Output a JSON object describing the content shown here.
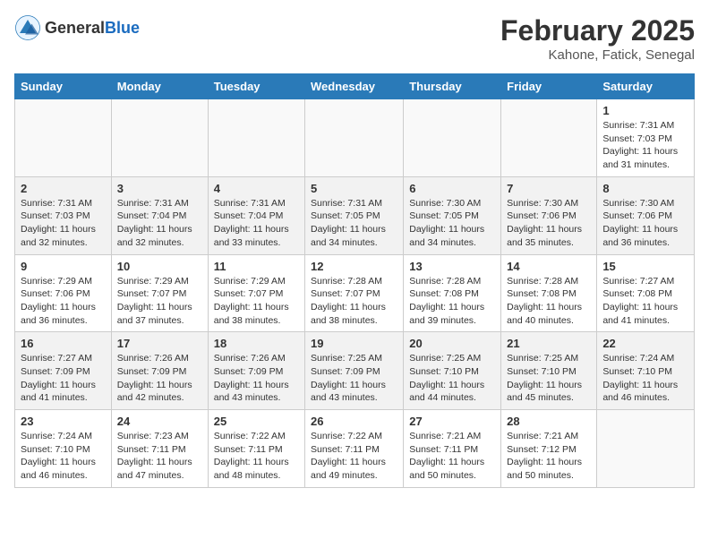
{
  "header": {
    "logo_general": "General",
    "logo_blue": "Blue",
    "month": "February 2025",
    "location": "Kahone, Fatick, Senegal"
  },
  "weekdays": [
    "Sunday",
    "Monday",
    "Tuesday",
    "Wednesday",
    "Thursday",
    "Friday",
    "Saturday"
  ],
  "weeks": [
    [
      {
        "day": "",
        "sunrise": "",
        "sunset": "",
        "daylight": "",
        "empty": true
      },
      {
        "day": "",
        "sunrise": "",
        "sunset": "",
        "daylight": "",
        "empty": true
      },
      {
        "day": "",
        "sunrise": "",
        "sunset": "",
        "daylight": "",
        "empty": true
      },
      {
        "day": "",
        "sunrise": "",
        "sunset": "",
        "daylight": "",
        "empty": true
      },
      {
        "day": "",
        "sunrise": "",
        "sunset": "",
        "daylight": "",
        "empty": true
      },
      {
        "day": "",
        "sunrise": "",
        "sunset": "",
        "daylight": "",
        "empty": true
      },
      {
        "day": "1",
        "sunrise": "Sunrise: 7:31 AM",
        "sunset": "Sunset: 7:03 PM",
        "daylight": "Daylight: 11 hours and 31 minutes.",
        "empty": false
      }
    ],
    [
      {
        "day": "2",
        "sunrise": "Sunrise: 7:31 AM",
        "sunset": "Sunset: 7:03 PM",
        "daylight": "Daylight: 11 hours and 32 minutes.",
        "empty": false
      },
      {
        "day": "3",
        "sunrise": "Sunrise: 7:31 AM",
        "sunset": "Sunset: 7:04 PM",
        "daylight": "Daylight: 11 hours and 32 minutes.",
        "empty": false
      },
      {
        "day": "4",
        "sunrise": "Sunrise: 7:31 AM",
        "sunset": "Sunset: 7:04 PM",
        "daylight": "Daylight: 11 hours and 33 minutes.",
        "empty": false
      },
      {
        "day": "5",
        "sunrise": "Sunrise: 7:31 AM",
        "sunset": "Sunset: 7:05 PM",
        "daylight": "Daylight: 11 hours and 34 minutes.",
        "empty": false
      },
      {
        "day": "6",
        "sunrise": "Sunrise: 7:30 AM",
        "sunset": "Sunset: 7:05 PM",
        "daylight": "Daylight: 11 hours and 34 minutes.",
        "empty": false
      },
      {
        "day": "7",
        "sunrise": "Sunrise: 7:30 AM",
        "sunset": "Sunset: 7:06 PM",
        "daylight": "Daylight: 11 hours and 35 minutes.",
        "empty": false
      },
      {
        "day": "8",
        "sunrise": "Sunrise: 7:30 AM",
        "sunset": "Sunset: 7:06 PM",
        "daylight": "Daylight: 11 hours and 36 minutes.",
        "empty": false
      }
    ],
    [
      {
        "day": "9",
        "sunrise": "Sunrise: 7:29 AM",
        "sunset": "Sunset: 7:06 PM",
        "daylight": "Daylight: 11 hours and 36 minutes.",
        "empty": false
      },
      {
        "day": "10",
        "sunrise": "Sunrise: 7:29 AM",
        "sunset": "Sunset: 7:07 PM",
        "daylight": "Daylight: 11 hours and 37 minutes.",
        "empty": false
      },
      {
        "day": "11",
        "sunrise": "Sunrise: 7:29 AM",
        "sunset": "Sunset: 7:07 PM",
        "daylight": "Daylight: 11 hours and 38 minutes.",
        "empty": false
      },
      {
        "day": "12",
        "sunrise": "Sunrise: 7:28 AM",
        "sunset": "Sunset: 7:07 PM",
        "daylight": "Daylight: 11 hours and 38 minutes.",
        "empty": false
      },
      {
        "day": "13",
        "sunrise": "Sunrise: 7:28 AM",
        "sunset": "Sunset: 7:08 PM",
        "daylight": "Daylight: 11 hours and 39 minutes.",
        "empty": false
      },
      {
        "day": "14",
        "sunrise": "Sunrise: 7:28 AM",
        "sunset": "Sunset: 7:08 PM",
        "daylight": "Daylight: 11 hours and 40 minutes.",
        "empty": false
      },
      {
        "day": "15",
        "sunrise": "Sunrise: 7:27 AM",
        "sunset": "Sunset: 7:08 PM",
        "daylight": "Daylight: 11 hours and 41 minutes.",
        "empty": false
      }
    ],
    [
      {
        "day": "16",
        "sunrise": "Sunrise: 7:27 AM",
        "sunset": "Sunset: 7:09 PM",
        "daylight": "Daylight: 11 hours and 41 minutes.",
        "empty": false
      },
      {
        "day": "17",
        "sunrise": "Sunrise: 7:26 AM",
        "sunset": "Sunset: 7:09 PM",
        "daylight": "Daylight: 11 hours and 42 minutes.",
        "empty": false
      },
      {
        "day": "18",
        "sunrise": "Sunrise: 7:26 AM",
        "sunset": "Sunset: 7:09 PM",
        "daylight": "Daylight: 11 hours and 43 minutes.",
        "empty": false
      },
      {
        "day": "19",
        "sunrise": "Sunrise: 7:25 AM",
        "sunset": "Sunset: 7:09 PM",
        "daylight": "Daylight: 11 hours and 43 minutes.",
        "empty": false
      },
      {
        "day": "20",
        "sunrise": "Sunrise: 7:25 AM",
        "sunset": "Sunset: 7:10 PM",
        "daylight": "Daylight: 11 hours and 44 minutes.",
        "empty": false
      },
      {
        "day": "21",
        "sunrise": "Sunrise: 7:25 AM",
        "sunset": "Sunset: 7:10 PM",
        "daylight": "Daylight: 11 hours and 45 minutes.",
        "empty": false
      },
      {
        "day": "22",
        "sunrise": "Sunrise: 7:24 AM",
        "sunset": "Sunset: 7:10 PM",
        "daylight": "Daylight: 11 hours and 46 minutes.",
        "empty": false
      }
    ],
    [
      {
        "day": "23",
        "sunrise": "Sunrise: 7:24 AM",
        "sunset": "Sunset: 7:10 PM",
        "daylight": "Daylight: 11 hours and 46 minutes.",
        "empty": false
      },
      {
        "day": "24",
        "sunrise": "Sunrise: 7:23 AM",
        "sunset": "Sunset: 7:11 PM",
        "daylight": "Daylight: 11 hours and 47 minutes.",
        "empty": false
      },
      {
        "day": "25",
        "sunrise": "Sunrise: 7:22 AM",
        "sunset": "Sunset: 7:11 PM",
        "daylight": "Daylight: 11 hours and 48 minutes.",
        "empty": false
      },
      {
        "day": "26",
        "sunrise": "Sunrise: 7:22 AM",
        "sunset": "Sunset: 7:11 PM",
        "daylight": "Daylight: 11 hours and 49 minutes.",
        "empty": false
      },
      {
        "day": "27",
        "sunrise": "Sunrise: 7:21 AM",
        "sunset": "Sunset: 7:11 PM",
        "daylight": "Daylight: 11 hours and 50 minutes.",
        "empty": false
      },
      {
        "day": "28",
        "sunrise": "Sunrise: 7:21 AM",
        "sunset": "Sunset: 7:12 PM",
        "daylight": "Daylight: 11 hours and 50 minutes.",
        "empty": false
      },
      {
        "day": "",
        "sunrise": "",
        "sunset": "",
        "daylight": "",
        "empty": true
      }
    ]
  ]
}
